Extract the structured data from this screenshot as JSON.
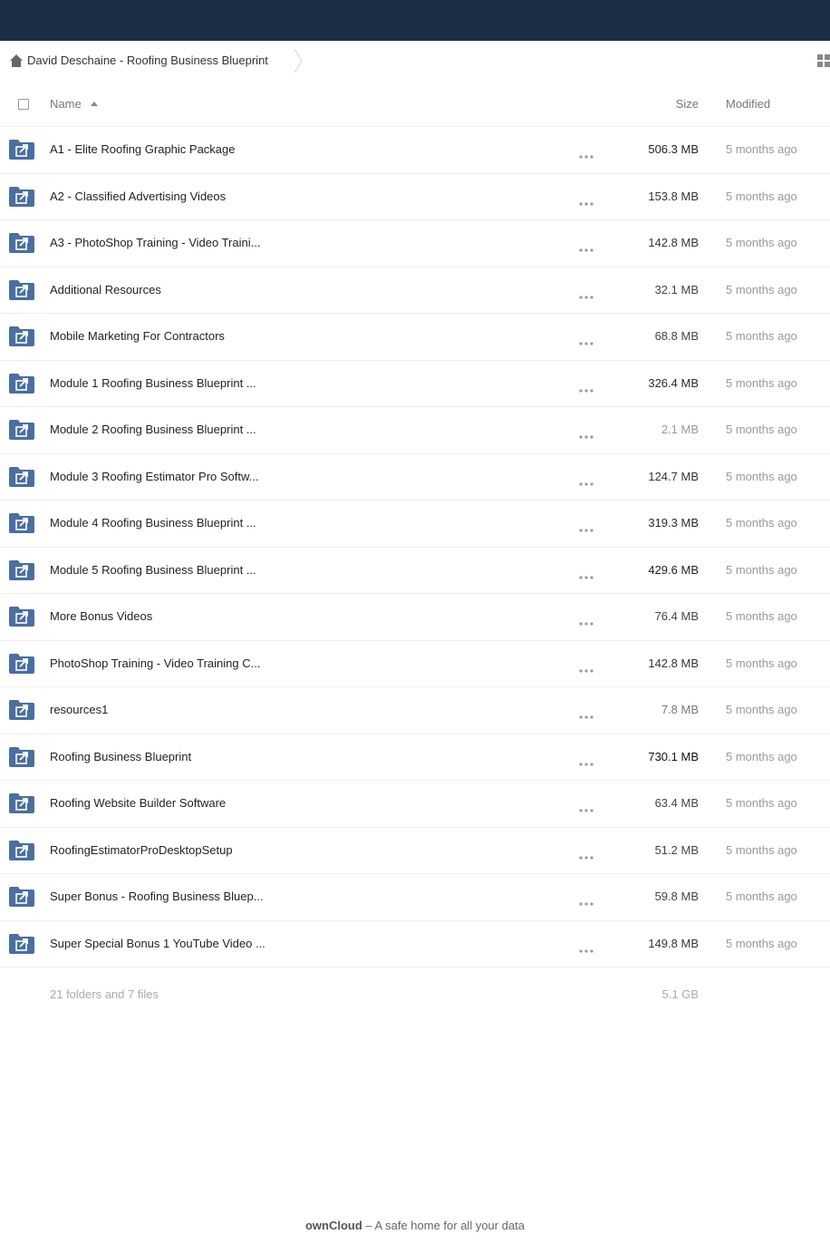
{
  "app": {
    "footer_brand": "ownCloud",
    "footer_tagline": " – A safe home for all your data"
  },
  "breadcrumb": {
    "home_icon": "home-icon",
    "title": "David Deschaine - Roofing Business Blueprint"
  },
  "header": {
    "name_label": "Name",
    "size_label": "Size",
    "modified_label": "Modified",
    "sort": "name-ascending"
  },
  "files": [
    {
      "name": "A1 - Elite Roofing Graphic Package",
      "size": "506.3 MB",
      "size_color": "#222222",
      "modified": "5 months ago"
    },
    {
      "name": "A2 - Classified Advertising Videos",
      "size": "153.8 MB",
      "size_color": "#333333",
      "modified": "5 months ago"
    },
    {
      "name": "A3 - PhotoShop Training - Video Traini...",
      "size": "142.8 MB",
      "size_color": "#333333",
      "modified": "5 months ago"
    },
    {
      "name": "Additional Resources",
      "size": "32.1 MB",
      "size_color": "#444444",
      "modified": "5 months ago"
    },
    {
      "name": "Mobile Marketing For Contractors",
      "size": "68.8 MB",
      "size_color": "#444444",
      "modified": "5 months ago"
    },
    {
      "name": "Module 1 Roofing Business Blueprint ...",
      "size": "326.4 MB",
      "size_color": "#2a2a2a",
      "modified": "5 months ago"
    },
    {
      "name": "Module 2 Roofing Business Blueprint ...",
      "size": "2.1 MB",
      "size_color": "#9a9a9a",
      "modified": "5 months ago"
    },
    {
      "name": "Module 3 Roofing Estimator Pro Softw...",
      "size": "124.7 MB",
      "size_color": "#333333",
      "modified": "5 months ago"
    },
    {
      "name": "Module 4 Roofing Business Blueprint ...",
      "size": "319.3 MB",
      "size_color": "#2a2a2a",
      "modified": "5 months ago"
    },
    {
      "name": "Module 5 Roofing Business Blueprint ...",
      "size": "429.6 MB",
      "size_color": "#222222",
      "modified": "5 months ago"
    },
    {
      "name": "More Bonus Videos",
      "size": "76.4 MB",
      "size_color": "#444444",
      "modified": "5 months ago"
    },
    {
      "name": "PhotoShop Training - Video Training C...",
      "size": "142.8 MB",
      "size_color": "#333333",
      "modified": "5 months ago"
    },
    {
      "name": "resources1",
      "size": "7.8 MB",
      "size_color": "#777777",
      "modified": "5 months ago"
    },
    {
      "name": "Roofing Business Blueprint",
      "size": "730.1 MB",
      "size_color": "#111111",
      "modified": "5 months ago"
    },
    {
      "name": "Roofing Website Builder Software",
      "size": "63.4 MB",
      "size_color": "#444444",
      "modified": "5 months ago"
    },
    {
      "name": "RoofingEstimatorProDesktopSetup",
      "size": "51.2 MB",
      "size_color": "#444444",
      "modified": "5 months ago"
    },
    {
      "name": "Super Bonus - Roofing Business Bluep...",
      "size": "59.8 MB",
      "size_color": "#444444",
      "modified": "5 months ago"
    },
    {
      "name": "Super Special Bonus 1 YouTube Video ...",
      "size": "149.8 MB",
      "size_color": "#333333",
      "modified": "5 months ago"
    }
  ],
  "summary": {
    "text": "21 folders and 7 files",
    "total_size": "5.1 GB"
  },
  "colors": {
    "topbar": "#1d2d44",
    "folder_icon": "#4a6fa0"
  }
}
